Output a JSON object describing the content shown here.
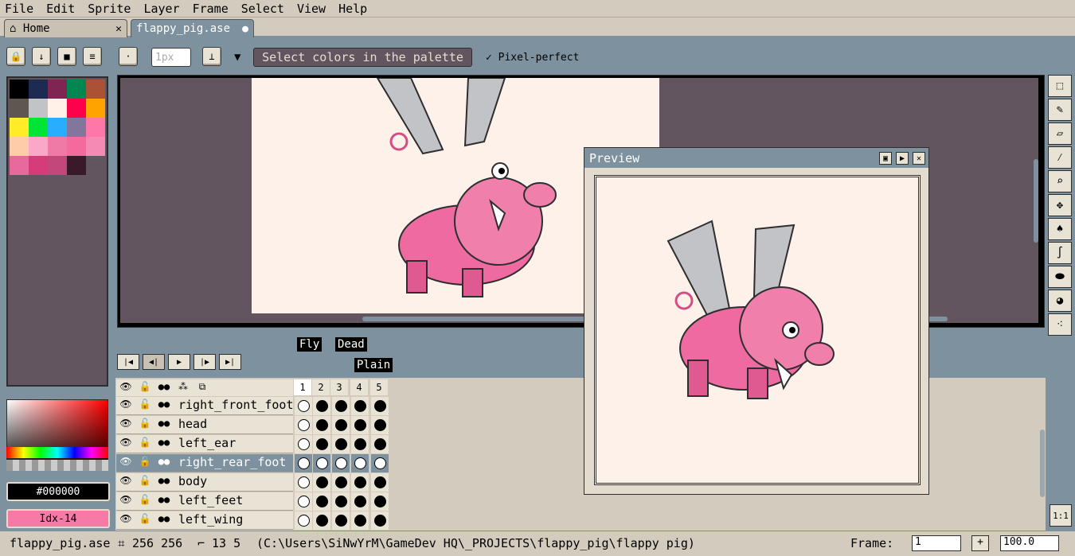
{
  "menu": [
    "File",
    "Edit",
    "Sprite",
    "Layer",
    "Frame",
    "Select",
    "View",
    "Help"
  ],
  "tabs": {
    "home": "Home",
    "file": "flappy_pig.ase"
  },
  "toolbar": {
    "brush_size_placeholder": "1px",
    "status_message": "Select colors in the palette",
    "pixel_perfect": "Pixel-perfect"
  },
  "palette": {
    "colors": [
      "#000000",
      "#1d2b53",
      "#7e2553",
      "#008751",
      "#ab5236",
      "#5f574f",
      "#c2c3c7",
      "#fff1e8",
      "#ff004d",
      "#ffa300",
      "#ffec27",
      "#00e436",
      "#29adff",
      "#83769c",
      "#ff77a8",
      "#ffccaa",
      "#f9a8c8",
      "#ee7aa5",
      "#f26b9c",
      "#f58bb4",
      "#e86a9c",
      "#d63b7a",
      "#c2477a",
      "#3a1a2a"
    ]
  },
  "preview": {
    "title": "Preview"
  },
  "color": {
    "hex": "#000000",
    "index": "Idx-14"
  },
  "timeline": {
    "tags": [
      "Fly",
      "Dead",
      "Plain"
    ],
    "frames": [
      "1",
      "2",
      "3",
      "4",
      "5"
    ],
    "layers": [
      {
        "name": "right_front_foot"
      },
      {
        "name": "head"
      },
      {
        "name": "left_ear"
      },
      {
        "name": "right_rear_foot"
      },
      {
        "name": "body"
      },
      {
        "name": "left_feet"
      },
      {
        "name": "left_wing"
      }
    ]
  },
  "status": {
    "filename": "flappy_pig.ase",
    "size": "256 256",
    "pos": "13 5",
    "path": "(C:\\Users\\SiNwYrM\\GameDev HQ\\_PROJECTS\\flappy_pig\\flappy pig)",
    "frame_label": "Frame:",
    "frame_value": "1",
    "zoom": "100.0"
  }
}
